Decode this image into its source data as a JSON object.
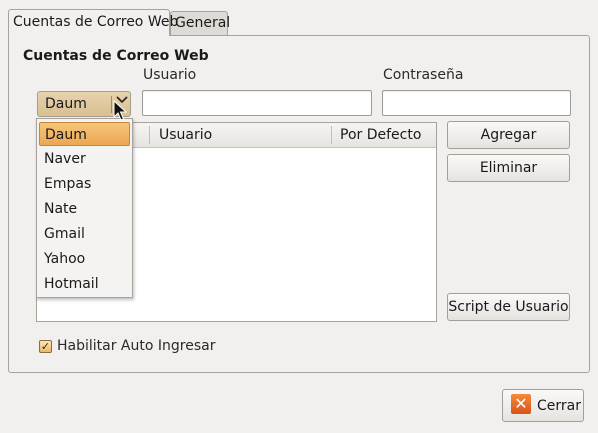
{
  "tabs": [
    {
      "label": "Cuentas de Correo Web",
      "active": true
    },
    {
      "label": "General",
      "active": false
    }
  ],
  "section": {
    "title": "Cuentas de Correo Web"
  },
  "fields": {
    "usuario_label": "Usuario",
    "contrasena_label": "Contraseña",
    "usuario_value": "",
    "contrasena_value": ""
  },
  "provider_combo": {
    "selected": "Daum",
    "options": [
      "Daum",
      "Naver",
      "Empas",
      "Nate",
      "Gmail",
      "Yahoo",
      "Hotmail"
    ]
  },
  "accounts_table": {
    "columns": [
      "Usuario",
      "Por Defecto"
    ],
    "rows": []
  },
  "buttons": {
    "add": "Agregar",
    "remove": "Eliminar",
    "script": "Script de Usuario",
    "close": "Cerrar"
  },
  "auto_login": {
    "label": "Habilitar Auto Ingresar",
    "checked": true
  },
  "colors": {
    "accent": "#eba752",
    "close_icon": "#e2622a"
  }
}
